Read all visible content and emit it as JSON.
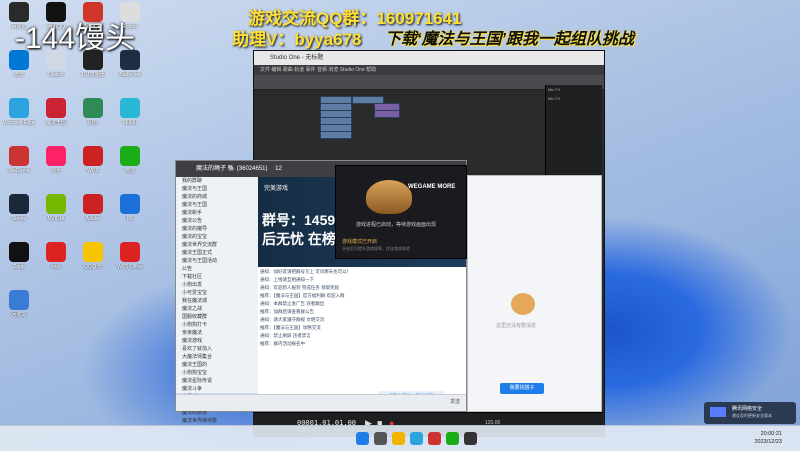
{
  "stream_overlay": {
    "title": "-144馒头",
    "qq_group": "游戏交流QQ群：160971641",
    "assistant": "助理V：byya678",
    "promo": "下载‘魔法与王国’跟我一起组队挑战"
  },
  "daw": {
    "window_title": "Studio One - 无标题",
    "menu": "文件  编辑  歌曲  轨道  事件  音频  浏览  Studio One  帮助",
    "transport_time": "00001.01.01.00",
    "tempo": "120.00",
    "mixer_labels": [
      "Mic FX",
      "Mic FX"
    ]
  },
  "qq_window": {
    "title": "魔法的绳子 🐘 (36024651)",
    "count": "12",
    "group_list": [
      "我的群聊",
      "魔法与王国",
      "魔法的商城",
      "魔法与王国",
      "魔法新手",
      "魔法公告",
      "魔法的魔导",
      "魔法的宝宝",
      "魔法世界交流群",
      "魔法王国正式",
      "魔法与王国活动",
      "公告",
      "下载社区",
      "小狗出发",
      "小可爱宝宝",
      "我在魔法城",
      "魔法之战",
      "国服收藏群",
      "小狗狗打卡",
      "亲亲魔法",
      "魔法游戏",
      "喜欢了就加入",
      "大魔法师集合",
      "魔法王国的",
      "小狗狗宝宝",
      "魔法星际传说",
      "魔法斗争",
      "小呆毛",
      "Fan的群",
      "魔法的旅途",
      "魔法世界接待群"
    ],
    "selected_group": "小呆毛",
    "banner_line1": "群号：1459302676",
    "banner_line2": "后无忧 在榜大神",
    "banner_brand": "完美游戏",
    "messages": [
      "通知：加好友请把群号写上 可问哪天也可以！",
      "通知：上线请互相通知一下",
      "通知：欢迎新人报到 完成任务 领取奖励",
      "推荐：【魔法与王国】官方福利群 欢迎入群",
      "通知：本群禁止发广告 违者踢出",
      "推荐：加群后请查看群公告",
      "通知：请大家遵守群规 文明交流",
      "推荐：【魔法与王国】攻略交流",
      "通知：禁止刷屏 违者禁言",
      "推荐：群内活动报名中"
    ],
    "send_button": "发送",
    "chat_hint": "点我上滑动，自动加载",
    "join_button": "我要找搭子",
    "empty_hint": "这里还没有群消息"
  },
  "wegame": {
    "logo": "WEGAME MORE",
    "text1": "游戏进程已启动，等待游戏画面出现",
    "text2": "游戏模式已开启",
    "text3": "开启后可提升游戏帧率，优化游戏体验"
  },
  "desktop_icons": [
    {
      "label": "网易云",
      "color": "#2a2a2a"
    },
    {
      "label": "腾讯QQ",
      "color": "#111"
    },
    {
      "label": "VOICE",
      "color": "#d1352a"
    },
    {
      "label": "Roblox",
      "color": "#ddd"
    },
    {
      "label": "微软",
      "color": "#0078d4"
    },
    {
      "label": "Ubisoft",
      "color": "#d0d8e6"
    },
    {
      "label": "UU加速器",
      "color": "#222"
    },
    {
      "label": "Battle.net",
      "color": "#1f2d44"
    },
    {
      "label": "Microsoft Edge",
      "color": "#2da3e0"
    },
    {
      "label": "魔法王国",
      "color": "#c23"
    },
    {
      "label": "图标",
      "color": "#2e8b57"
    },
    {
      "label": "MuMu",
      "color": "#29b7d6"
    },
    {
      "label": "WeGame",
      "color": "#c33"
    },
    {
      "label": "快手",
      "color": "#f26"
    },
    {
      "label": "WPS",
      "color": "#c22"
    },
    {
      "label": "微信",
      "color": "#1aad19"
    },
    {
      "label": "Steam",
      "color": "#1b2838"
    },
    {
      "label": "NVIDIA",
      "color": "#76b900"
    },
    {
      "label": "Adobe",
      "color": "#c22"
    },
    {
      "label": "KK",
      "color": "#1e6fd9"
    },
    {
      "label": "Zepp",
      "color": "#111"
    },
    {
      "label": "网易",
      "color": "#d22"
    },
    {
      "label": "QQ音乐",
      "color": "#f6c500"
    },
    {
      "label": "WPS Office",
      "color": "#d22"
    },
    {
      "label": "回收站",
      "color": "#3a7bd5"
    }
  ],
  "notification": {
    "title": "腾讯网络安全",
    "subtitle": "建议及时更新安全版本"
  },
  "clock": {
    "time": "20:00:21",
    "date": "2023/12/23"
  }
}
